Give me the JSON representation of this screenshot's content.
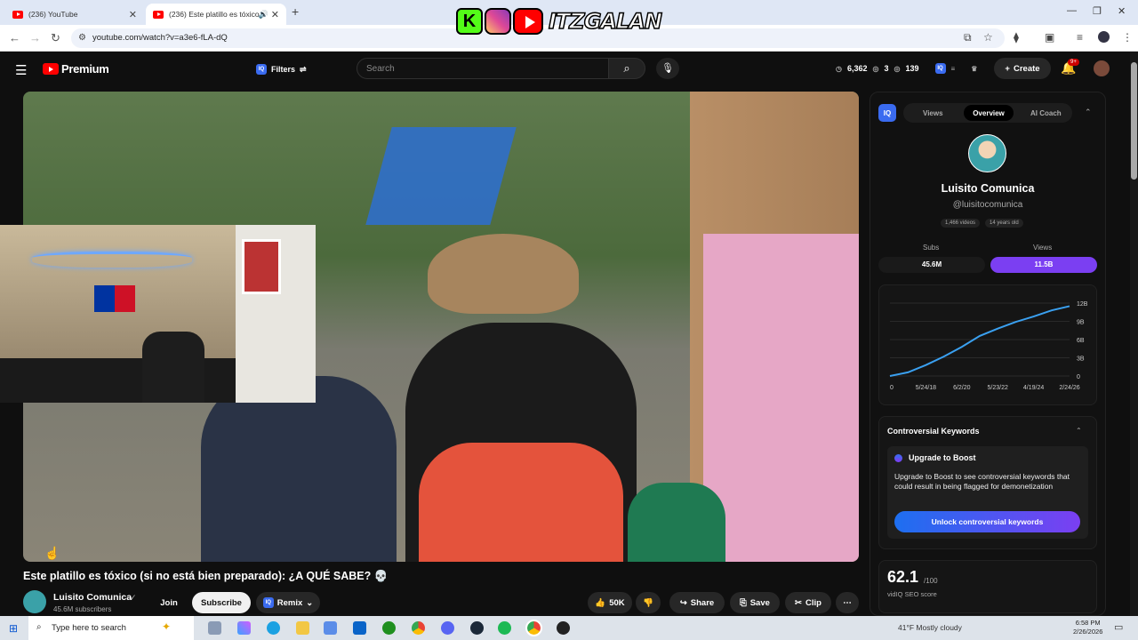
{
  "browser": {
    "tabs": [
      {
        "label": "(236) YouTube"
      },
      {
        "label": "(236) Este platillo es tóxico"
      }
    ],
    "url": "youtube.com/watch?v=a3e6-fLA-dQ"
  },
  "overlay": {
    "brand": "ITZGALAN",
    "kick_letter": "K"
  },
  "header": {
    "logo_text": "Premium",
    "filters_label": "Filters",
    "iq_label": "IQ",
    "search_placeholder": "Search",
    "stats": {
      "views": "6,362",
      "a": "3",
      "b": "139"
    },
    "create_label": "Create",
    "notif_badge": "9+"
  },
  "video": {
    "title": "Este platillo es tóxico (si no está bien preparado): ¿A QUÉ SABE? 💀",
    "channel": "Luisito Comunica",
    "subscribers": "45.6M subscribers",
    "join": "Join",
    "subscribe": "Subscribe",
    "remix": "Remix",
    "likes": "50K",
    "share": "Share",
    "save": "Save",
    "clip": "Clip"
  },
  "panel": {
    "tabs": [
      "Views",
      "Overview",
      "AI Coach"
    ],
    "channel_name": "Luisito Comunica",
    "handle": "@luisitocomunica",
    "chips": [
      "1,466 videos",
      "14 years old"
    ],
    "subs_label": "Subs",
    "views_label": "Views",
    "subs_value": "45.6M",
    "views_value": "11.5B",
    "controversial": {
      "title": "Controversial Keywords",
      "upgrade": "Upgrade to Boost",
      "description": "Upgrade to Boost to see controversial keywords that could result in being flagged for demonetization",
      "button": "Unlock controversial keywords"
    },
    "seo": {
      "score": "62.1",
      "max": "/100",
      "label": "vidIQ SEO score"
    }
  },
  "chart_data": {
    "type": "line",
    "title": "",
    "xlabel": "",
    "ylabel": "",
    "x_ticks": [
      "0",
      "5/24/18",
      "6/2/20",
      "5/23/22",
      "4/19/24",
      "2/24/26"
    ],
    "y_ticks": [
      "0",
      "3B",
      "6B",
      "9B",
      "12B"
    ],
    "ylim": [
      0,
      12
    ],
    "line_color": "#3aa0f0",
    "x": [
      0,
      0.5,
      1,
      1.5,
      2,
      2.5,
      3,
      3.5,
      4,
      4.5,
      5
    ],
    "values": [
      0,
      0.6,
      1.8,
      3.2,
      4.8,
      6.6,
      7.8,
      8.9,
      9.8,
      10.8,
      11.5
    ]
  },
  "taskbar": {
    "search": "Type here to search",
    "weather": "41°F  Mostly cloudy",
    "time": "6:58 PM",
    "date": "2/26/2026"
  }
}
